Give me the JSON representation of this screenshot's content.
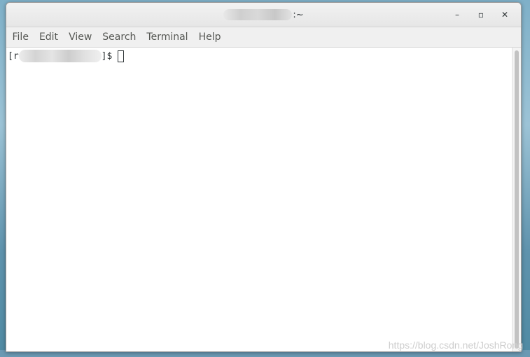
{
  "window": {
    "title_suffix": ":~",
    "controls": {
      "minimize": "–",
      "maximize": "▫",
      "close": "✕"
    }
  },
  "menu": {
    "items": [
      "File",
      "Edit",
      "View",
      "Search",
      "Terminal",
      "Help"
    ]
  },
  "terminal": {
    "prompt_open": "[r",
    "prompt_close": "]$ "
  },
  "watermark": "https://blog.csdn.net/JoshRong",
  "icons": {
    "minimize": "minimize-icon",
    "maximize": "maximize-icon",
    "close": "close-icon"
  },
  "colors": {
    "titlebar": "#e9e9e9",
    "menubar": "#f0f0f0",
    "terminal_bg": "#ffffff",
    "terminal_fg": "#2e3436",
    "desktop": "#7fb0c8"
  }
}
